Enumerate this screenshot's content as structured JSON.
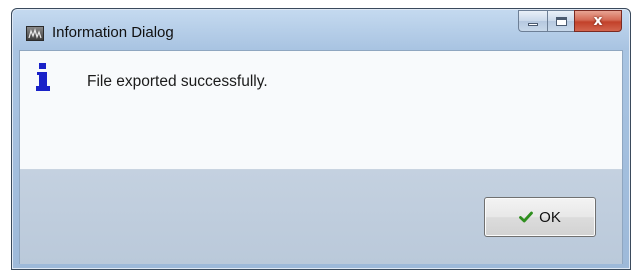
{
  "window": {
    "title": "Information Dialog",
    "app_icon": "application-icon",
    "controls": {
      "minimize_icon": "minimize-icon",
      "maximize_icon": "maximize-icon",
      "close_icon": "close-icon",
      "close_glyph": "x"
    }
  },
  "dialog": {
    "icon": "info-icon",
    "message": "File exported successfully.",
    "ok_button": {
      "icon": "checkmark-icon",
      "label": "OK"
    }
  },
  "colors": {
    "info_icon": "#1a22c8",
    "check_icon": "#2f8f1f",
    "close_button": "#c8452e"
  }
}
